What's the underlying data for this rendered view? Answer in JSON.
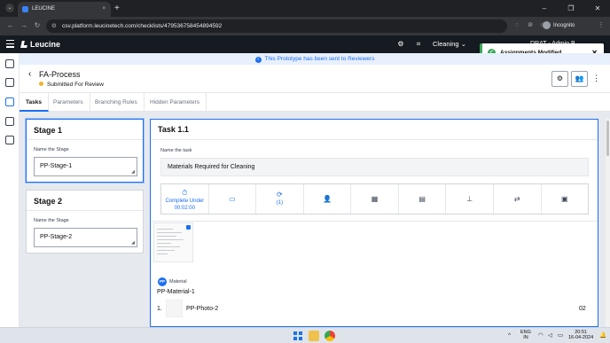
{
  "browser": {
    "tab_title": "LEUCINE",
    "url": "csv.platform.leucinetech.com/checklists/479536758454894592",
    "incognito_label": "Incognito"
  },
  "app": {
    "brand": "Leucine",
    "facility": "Cleaning",
    "user_label": "DRAT - Admin B..."
  },
  "toast": {
    "message": "Assignments Modified",
    "color": "#3aa757"
  },
  "banner": {
    "text": "This Prototype has been sent to Reviewers"
  },
  "process": {
    "title": "FA-Process",
    "status": "Submitted For Review",
    "status_color": "#f1b42f"
  },
  "tabs": [
    {
      "label": "Tasks"
    },
    {
      "label": "Parameters"
    },
    {
      "label": "Branching Rules"
    },
    {
      "label": "Hidden Parameters"
    }
  ],
  "stages": [
    {
      "title": "Stage 1",
      "field_label": "Name the Stage",
      "value": "PP-Stage-1"
    },
    {
      "title": "Stage 2",
      "field_label": "Name the Stage",
      "value": "PP-Stage-2"
    }
  ],
  "task": {
    "title": "Task 1.1",
    "field_label": "Name the task",
    "value": "Materials Required for Cleaning",
    "timer_label": "Complete Under",
    "timer_value": "00:02:00",
    "recurrence_count": "(1)",
    "material_label": "Material",
    "material_name": "PP-Material-1",
    "material_index": "1.",
    "photo_name": "PP-Photo-2",
    "quantity": "02"
  },
  "taskbar": {
    "lang_top": "ENG",
    "lang_bottom": "IN",
    "time": "20:51",
    "date": "16-04-2024"
  },
  "accent_color": "#1d6ff2"
}
